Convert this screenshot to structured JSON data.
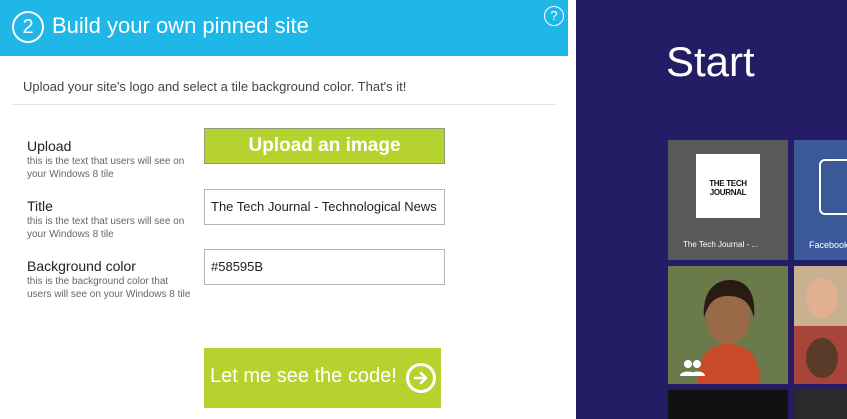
{
  "header": {
    "step_number": "2",
    "title": "Build your own pinned site",
    "help_glyph": "?"
  },
  "intro": "Upload your site's logo and select a tile background color. That's it!",
  "form": {
    "upload": {
      "label": "Upload",
      "hint": "this is the text that users will see on your Windows 8 tile",
      "button_label": "Upload an image"
    },
    "title": {
      "label": "Title",
      "hint": "this is the text that users will see on your Windows 8 tile",
      "value": "The Tech Journal - Technological News"
    },
    "background": {
      "label": "Background color",
      "hint": "this is the background color that users will see on your Windows 8 tile",
      "value": "#58595B"
    },
    "submit_label": "Let me see the code!"
  },
  "start_screen": {
    "heading": "Start",
    "tiles": [
      {
        "name": "The Tech Journal - ...",
        "logo_text": "THE TECH JOURNAL",
        "color": "#58595b"
      },
      {
        "name": "Facebook",
        "color": "#3b5998"
      }
    ]
  },
  "colors": {
    "header": "#1fb6e8",
    "accent_button": "#b6d22e",
    "start_background": "#241d65"
  }
}
